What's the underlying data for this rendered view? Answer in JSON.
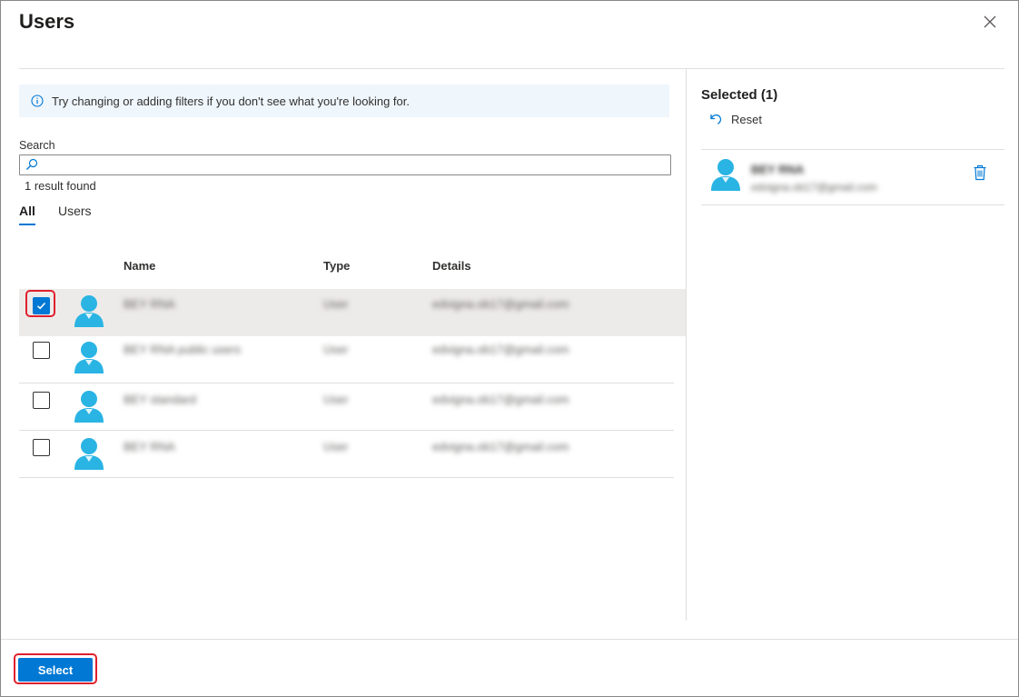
{
  "dialog": {
    "title": "Users",
    "close_icon": "close-icon"
  },
  "info": {
    "icon": "info-icon",
    "text": "Try changing or adding filters if you don't see what you're looking for."
  },
  "search": {
    "label": "Search",
    "value": "",
    "placeholder": "",
    "result_count": "1 result found"
  },
  "tabs": [
    {
      "label": "All",
      "active": true
    },
    {
      "label": "Users",
      "active": false
    }
  ],
  "table": {
    "columns": [
      "Name",
      "Type",
      "Details"
    ],
    "rows": [
      {
        "checked": true,
        "name": "BEY RNA",
        "type": "User",
        "details": "edvigna.ob17@gmail.com"
      },
      {
        "checked": false,
        "name": "BEY RNA public users",
        "type": "User",
        "details": "edvigna.ob17@gmail.com"
      },
      {
        "checked": false,
        "name": "BEY standard",
        "type": "User",
        "details": "edvigna.ob17@gmail.com"
      },
      {
        "checked": false,
        "name": "BEY RNA",
        "type": "User",
        "details": "edvigna.ob17@gmail.com"
      }
    ]
  },
  "selected_panel": {
    "title": "Selected (1)",
    "reset_label": "Reset",
    "items": [
      {
        "name": "BEY RNA",
        "email": "edvigna.ob17@gmail.com"
      }
    ]
  },
  "footer": {
    "select_label": "Select"
  },
  "colors": {
    "accent": "#0078d4",
    "highlight": "#e0202e",
    "avatar": "#2ab4e3"
  }
}
